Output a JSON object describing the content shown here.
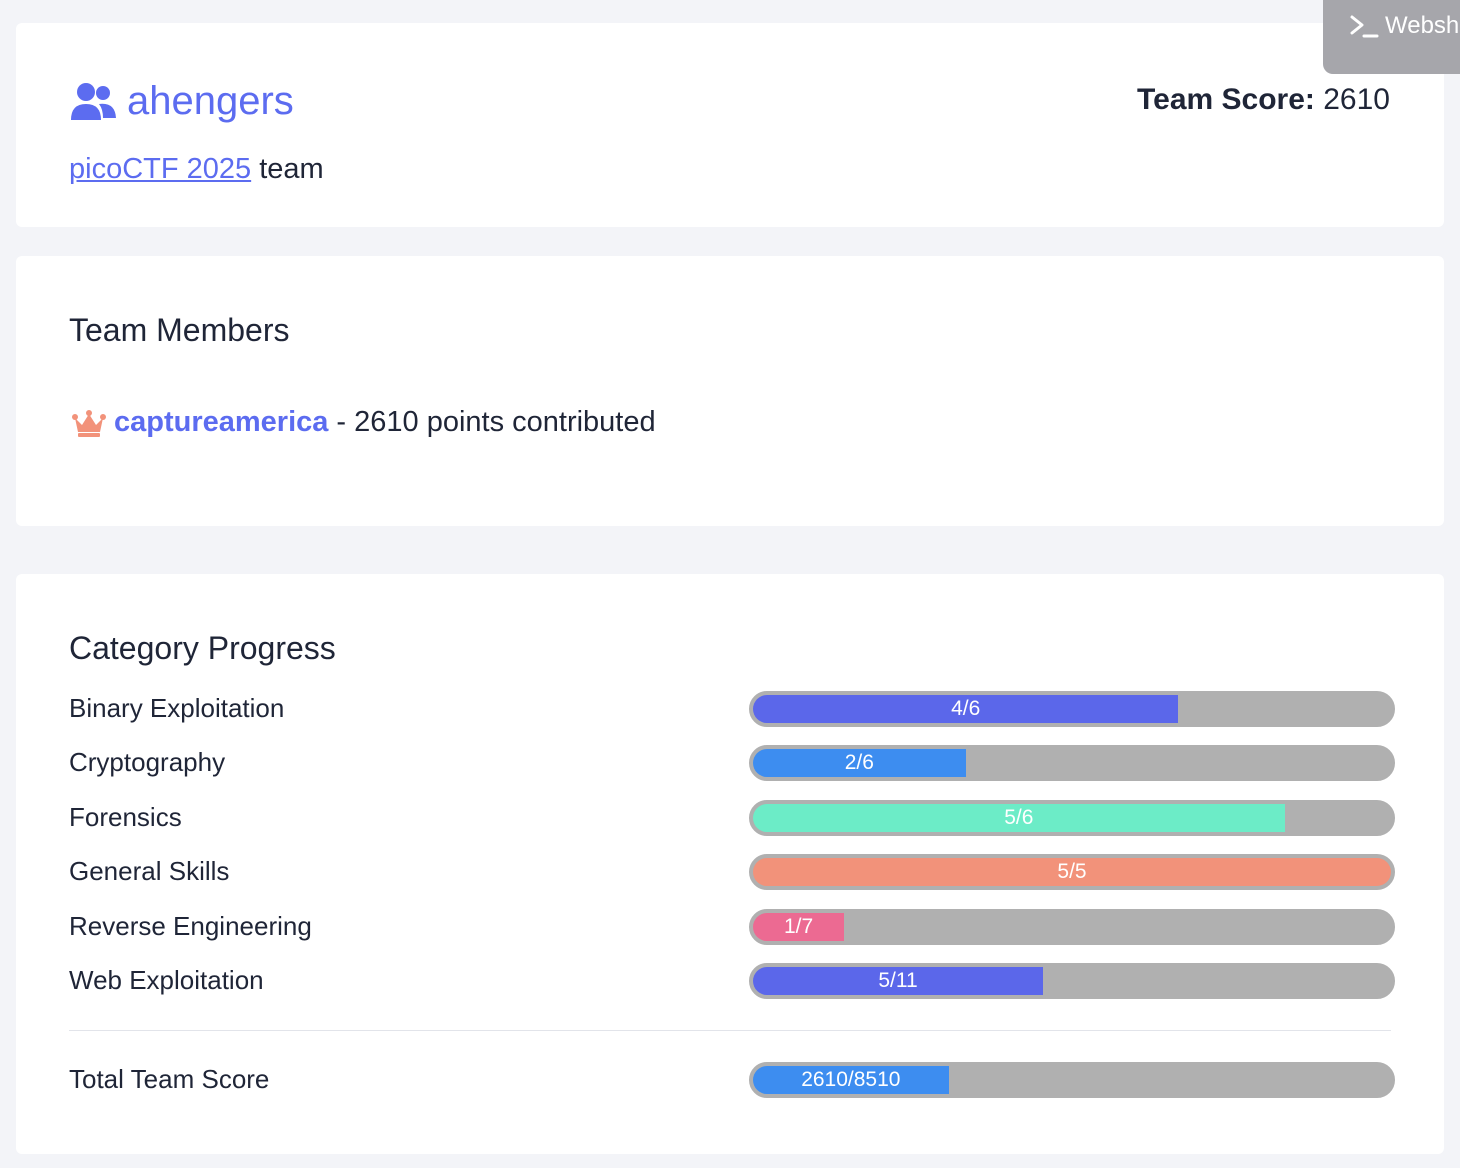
{
  "team": {
    "name": "ahengers",
    "score_label": "Team Score:",
    "score_value": "2610",
    "event_link": "picoCTF 2025",
    "event_suffix": " team"
  },
  "members": {
    "title": "Team Members",
    "items": [
      {
        "name": "captureamerica",
        "points_text": "- 2610 points contributed",
        "role_icon": "crown-icon"
      }
    ]
  },
  "progress": {
    "title": "Category Progress",
    "categories": [
      {
        "label": "Binary Exploitation",
        "value_text": "4/6",
        "solved": 4,
        "total": 6,
        "color": "#5b67ea"
      },
      {
        "label": "Cryptography",
        "value_text": "2/6",
        "solved": 2,
        "total": 6,
        "color": "#3d8df0"
      },
      {
        "label": "Forensics",
        "value_text": "5/6",
        "solved": 5,
        "total": 6,
        "color": "#6cecc7"
      },
      {
        "label": "General Skills",
        "value_text": "5/5",
        "solved": 5,
        "total": 5,
        "color": "#f2927a"
      },
      {
        "label": "Reverse Engineering",
        "value_text": "1/7",
        "solved": 1,
        "total": 7,
        "color": "#ec6a92"
      },
      {
        "label": "Web Exploitation",
        "value_text": "5/11",
        "solved": 5,
        "total": 11,
        "color": "#5b67ea"
      }
    ],
    "total": {
      "label": "Total Team Score",
      "value_text": "2610/8510",
      "solved": 2610,
      "total": 8510,
      "color": "#3d8df0"
    }
  },
  "webshell": {
    "label": "Websh",
    "icon": "terminal-icon"
  }
}
